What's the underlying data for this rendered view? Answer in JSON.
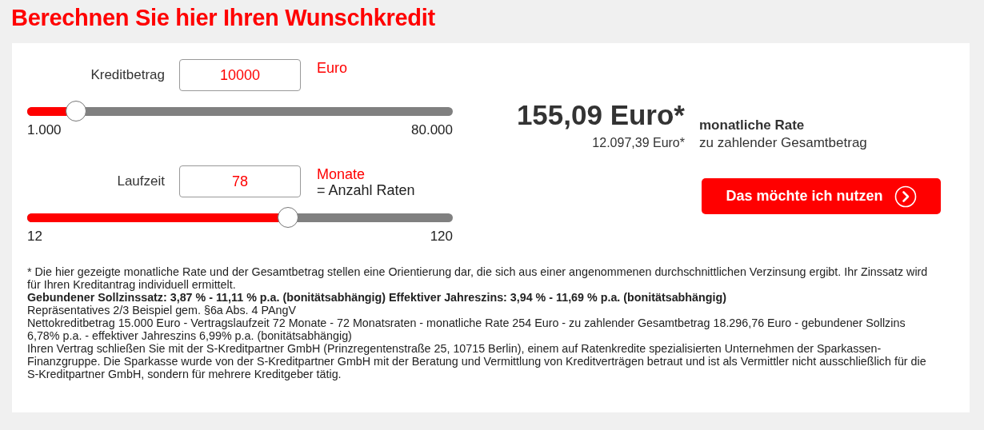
{
  "title": "Berechnen Sie hier Ihren Wunschkredit",
  "inputs": [
    {
      "label": "Kreditbetrag",
      "value": "10000",
      "unit": "Euro",
      "level": 0.115,
      "min": "1.000",
      "max": "80.000"
    },
    {
      "label": "Laufzeit",
      "value": "78",
      "unit": "Monate",
      "note": "= Anzahl Raten",
      "level": 0.612,
      "min": "12",
      "max": "120"
    }
  ],
  "result": {
    "rate": "155,09 Euro*",
    "rate_label": "monatliche Rate",
    "total": "12.097,39 Euro*",
    "total_label": "zu zahlender Gesamtbetrag"
  },
  "button": {
    "label": "Das möchte ich nutzen"
  },
  "footnotes": [
    "* Die hier gezeigte monatliche Rate und der Gesamtbetrag stellen eine Orientierung dar, die sich aus einer angenommenen durchschnittlichen Verzinsung ergibt. Ihr Zinssatz wird für Ihren Kreditantrag individuell ermittelt.",
    "**Gebundener Sollzinssatz: 3,87 % - 11,11 % p.a. (bonitätsabhängig) Effektiver Jahreszins: 3,94 % - 11,69 % p.a. (bonitätsabhängig)**",
    "Repräsentatives 2/3 Beispiel gem. §6a Abs. 4 PAngV",
    "Nettokreditbetrag 15.000 Euro - Vertragslaufzeit 72 Monate - 72 Monatsraten - monatliche Rate 254 Euro - zu zahlender Gesamtbetrag 18.296,76 Euro - gebundener Sollzins 6,78% p.a. - effektiver Jahreszins 6,99% p.a. (bonitätsabhängig)",
    "Ihren Vertrag schließen Sie mit der S-Kreditpartner GmbH (Prinzregentenstraße 25, 10715 Berlin), einem auf Ratenkredite spezialisierten Unternehmen der Sparkassen-Finanzgruppe. Die Sparkasse wurde von der S-Kreditpartner GmbH mit der Beratung und Vermittlung von Kreditverträgen betraut und ist als Vermittler nicht ausschließlich für die S-Kreditpartner GmbH, sondern für mehrere Kreditgeber tätig."
  ]
}
